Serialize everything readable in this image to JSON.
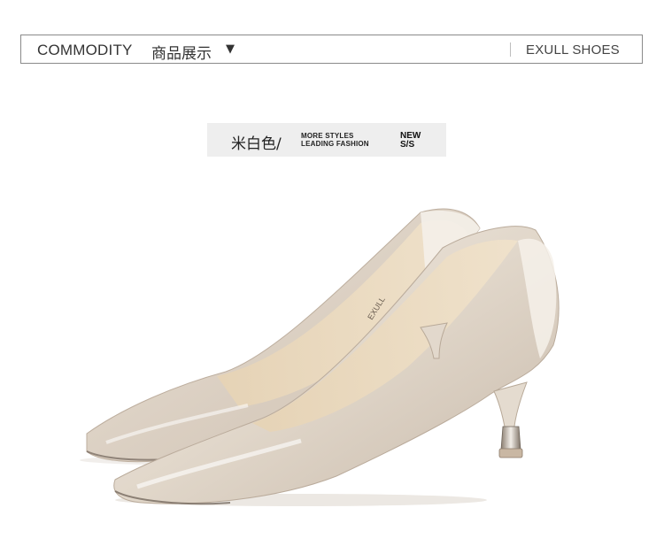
{
  "header": {
    "title": "COMMODITY",
    "subtitle": "商品展示",
    "arrow_icon": "triangle-down-icon",
    "brand": "EXULL SHOES"
  },
  "color_tag": {
    "color_name": "米白色/",
    "tagline_line1": "MORE STYLES",
    "tagline_line2": "LEADING FASHION",
    "season_line1": "NEW",
    "season_line2": "S/S"
  },
  "product": {
    "image_subject": "pair of beige patent leather pointed-toe kitten-heel pumps",
    "colors": {
      "patent": "#e2d8cc",
      "lining": "#e9d8bd",
      "heel_tip": "#c9b7a3"
    }
  }
}
